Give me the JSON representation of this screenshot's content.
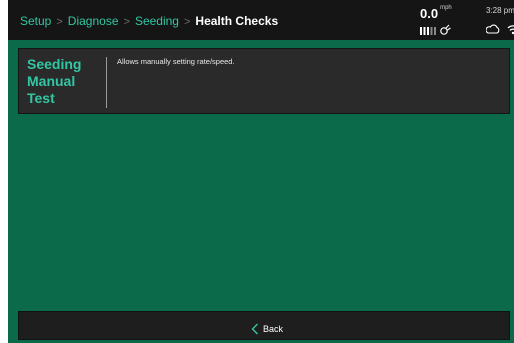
{
  "breadcrumb": {
    "items": [
      "Setup",
      "Diagnose",
      "Seeding"
    ],
    "separator": ">",
    "current": "Health Checks"
  },
  "status": {
    "speed_value": "0.0",
    "speed_unit": "mph",
    "time": "3:28 pm",
    "signal_icon": "signal-bars-icon",
    "gps_icon": "satellite-icon",
    "cloud_icon": "cloud-icon",
    "wifi_icon": "wifi-icon"
  },
  "test_card": {
    "title": "Seeding\nManual\nTest",
    "description": "Allows manually setting rate/speed."
  },
  "footer": {
    "back_label": "Back",
    "back_icon": "chevron-left-icon"
  },
  "colors": {
    "accent": "#32c7a3",
    "background": "#0b6a49",
    "bar": "#151515",
    "card": "#2a2a2a"
  }
}
